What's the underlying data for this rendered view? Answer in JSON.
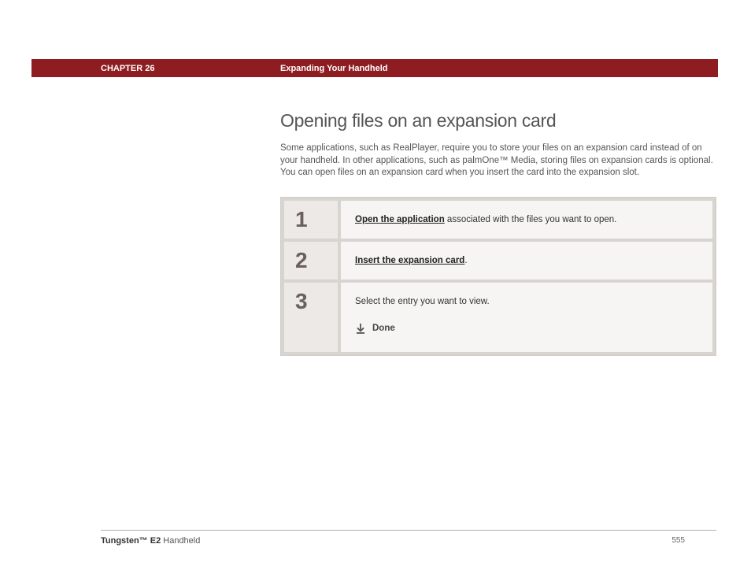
{
  "header": {
    "chapter_label": "CHAPTER 26",
    "chapter_title": "Expanding Your Handheld"
  },
  "main": {
    "heading": "Opening files on an expansion card",
    "intro": "Some applications, such as RealPlayer, require you to store your files on an expansion card instead of on your handheld. In other applications, such as palmOne™ Media, storing files on expansion cards is optional. You can open files on an expansion card when you insert the card into the expansion slot."
  },
  "steps": [
    {
      "num": "1",
      "link": "Open the application",
      "rest": " associated with the files you want to open."
    },
    {
      "num": "2",
      "link": "Insert the expansion card",
      "rest": "."
    },
    {
      "num": "3",
      "text": "Select the entry you want to view.",
      "done": "Done"
    }
  ],
  "footer": {
    "product_bold": "Tungsten™ E2",
    "product_rest": " Handheld",
    "page": "555"
  }
}
